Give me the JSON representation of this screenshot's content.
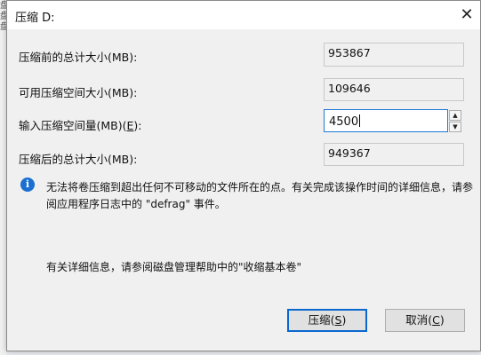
{
  "dialog": {
    "title": "压缩 D:",
    "close_glyph": "✕"
  },
  "fields": {
    "total_before_label": "压缩前的总计大小(MB):",
    "total_before_value": "953867",
    "available_label": "可用压缩空间大小(MB):",
    "available_value": "109646",
    "shrink_label_prefix": "输入压缩空间量(MB)(",
    "shrink_label_key": "E",
    "shrink_label_suffix": "):",
    "shrink_value": "4500",
    "total_after_label": "压缩后的总计大小(MB):",
    "total_after_value": "949367"
  },
  "info": {
    "icon": "info-icon",
    "text": "无法将卷压缩到超出任何不可移动的文件所在的点。有关完成该操作时间的详细信息，请参阅应用程序日志中的 \"defrag\" 事件。",
    "help": "有关详细信息，请参阅磁盘管理帮助中的\"收缩基本卷\""
  },
  "buttons": {
    "shrink_prefix": "压缩(",
    "shrink_key": "S",
    "shrink_suffix": ")",
    "cancel_prefix": "取消(",
    "cancel_key": "C",
    "cancel_suffix": ")"
  },
  "background": {
    "glyphs": [
      "盘",
      "盘",
      "盘"
    ]
  },
  "colors": {
    "accent": "#0a67d0",
    "info_icon": "#1a6fd1",
    "dialog_bg": "#f0f0f0"
  }
}
